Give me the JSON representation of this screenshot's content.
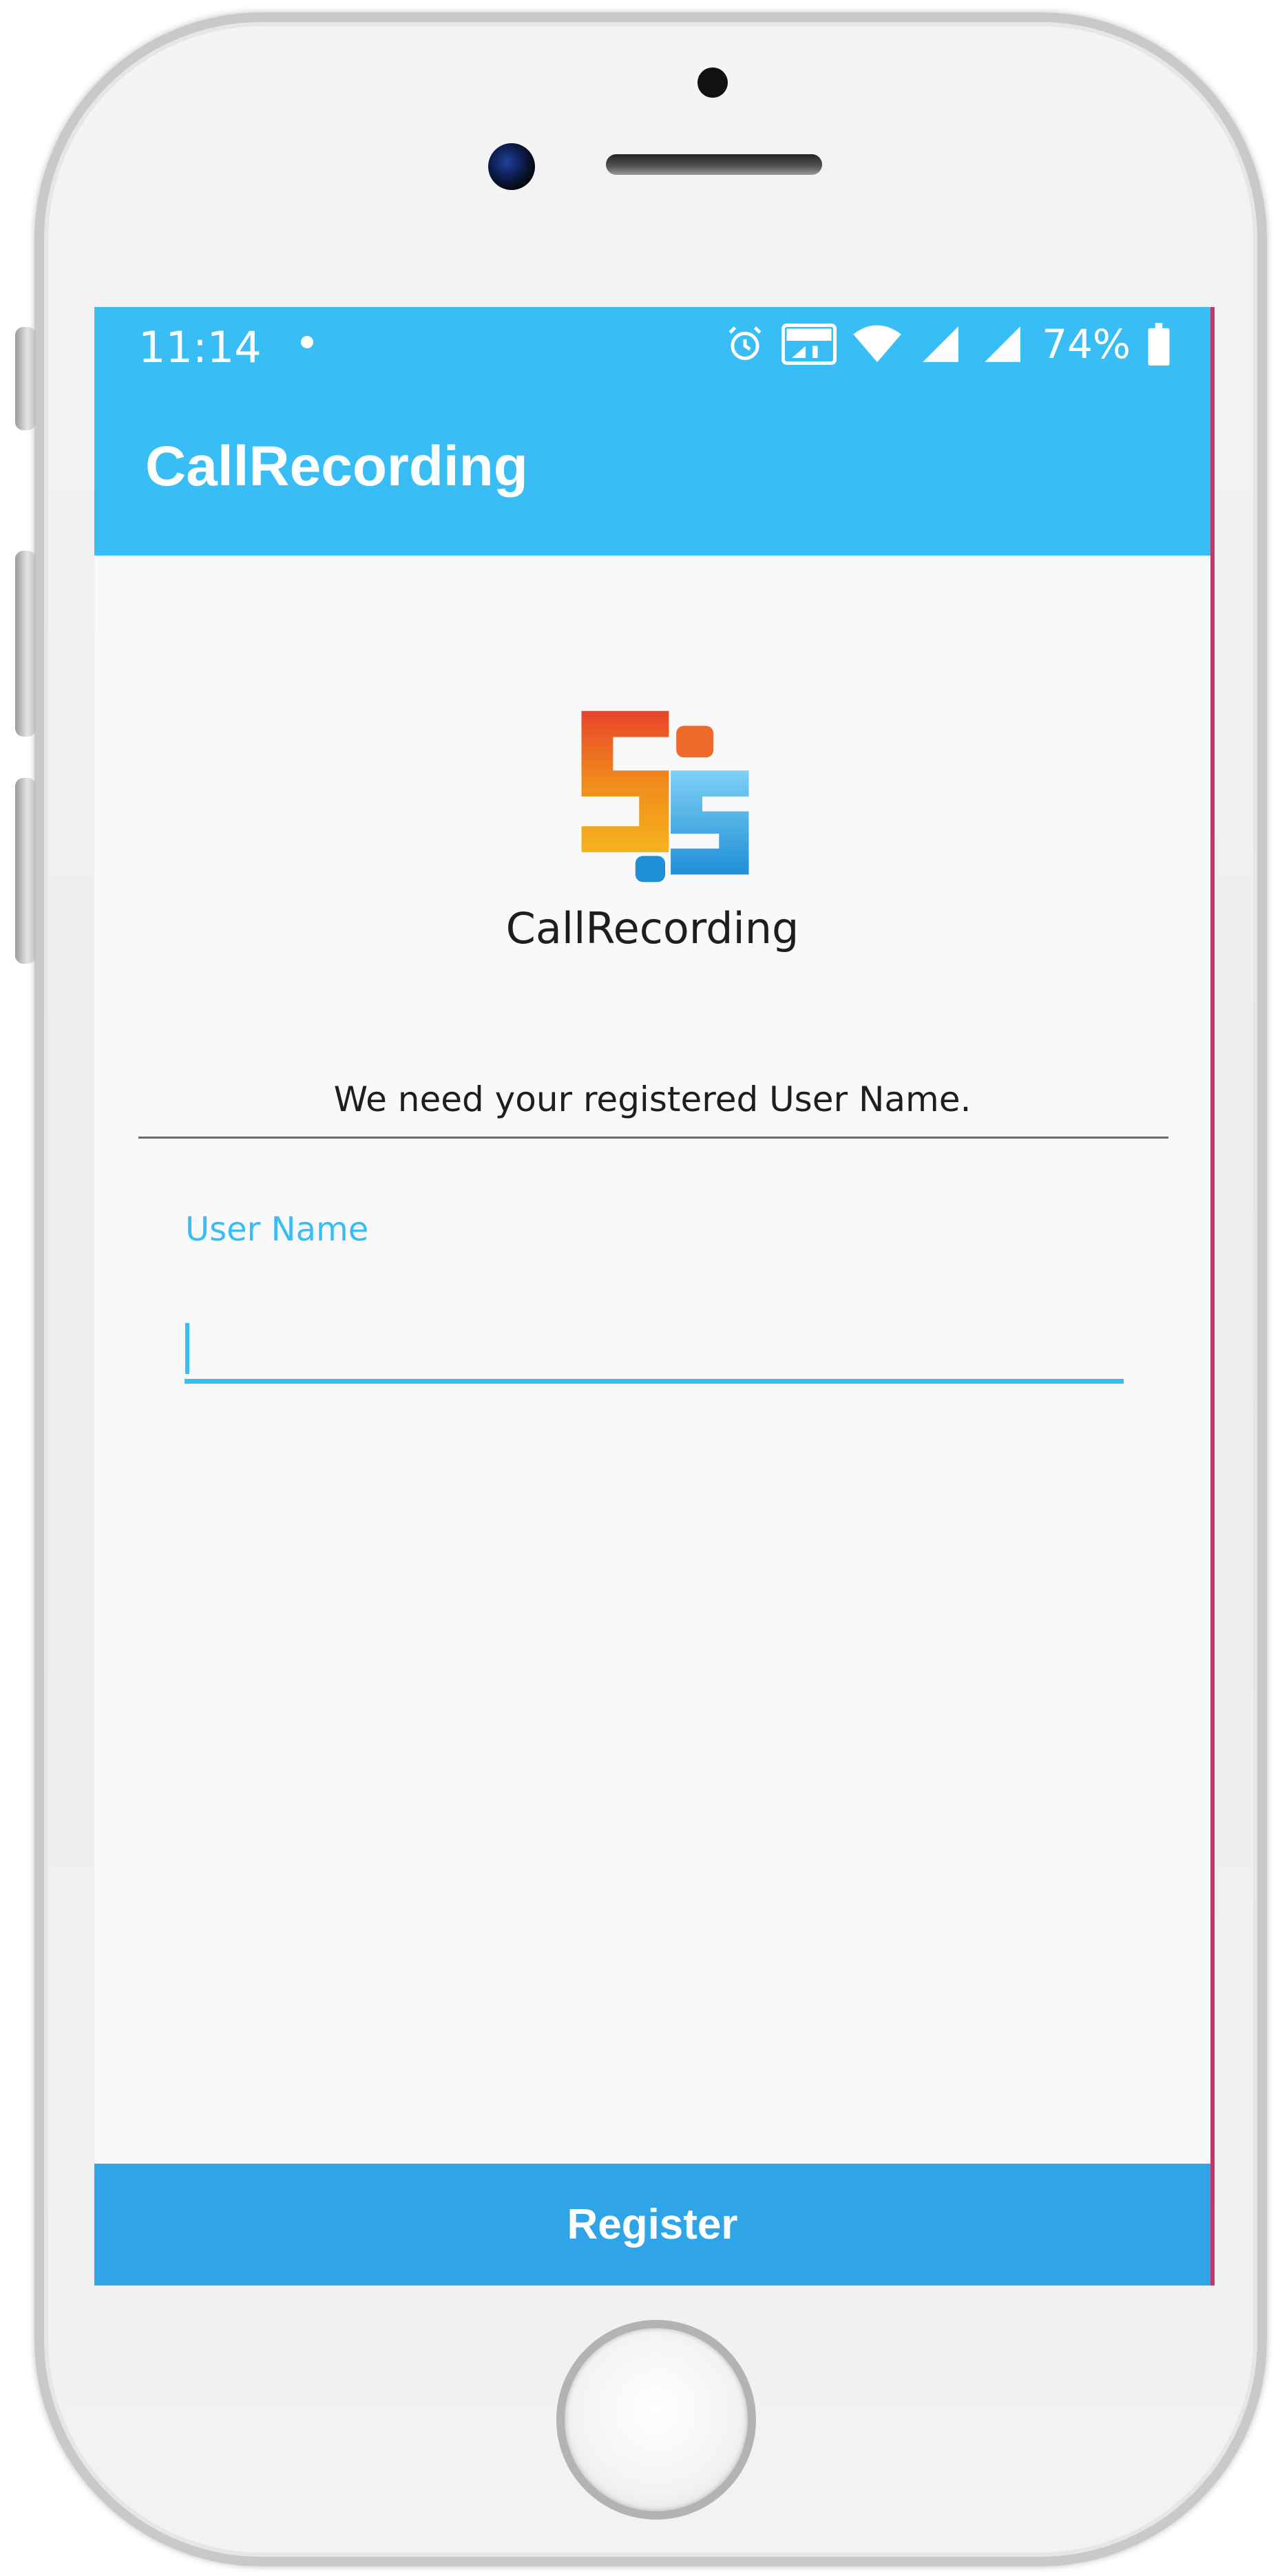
{
  "status_bar": {
    "time": "11:14",
    "battery_percent": "74%",
    "icons": [
      "alarm-icon",
      "volte-icon",
      "wifi-icon",
      "signal-icon",
      "signal-icon",
      "battery-icon"
    ]
  },
  "app_bar": {
    "title": "CallRecording"
  },
  "logo": {
    "icon": "app-logo-icon",
    "caption": "CallRecording"
  },
  "form": {
    "info_text": "We need your registered User Name.",
    "username_label": "User Name",
    "username_value": ""
  },
  "register_button": {
    "label": "Register"
  },
  "colors": {
    "primary": "#38bdf4",
    "button": "#2fa4e6",
    "background": "#f9f9f9"
  }
}
